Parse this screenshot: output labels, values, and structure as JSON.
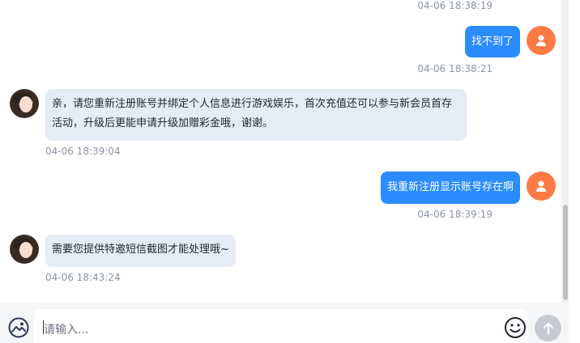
{
  "chat": {
    "messages": [
      {
        "type": "timestamp",
        "side": "right",
        "time": "04-06 18:38:19"
      },
      {
        "type": "message",
        "side": "right",
        "text": "找不到了",
        "time": "04-06 18:38:21",
        "avatar": "user-icon"
      },
      {
        "type": "message",
        "side": "left",
        "text": "亲，请您重新注册账号并绑定个人信息进行游戏娱乐，首次充值还可以参与新会员首存活动，升级后更能申请升级加赠彩金哦，谢谢。",
        "time": "04-06 18:39:04",
        "avatar": "agent-avatar"
      },
      {
        "type": "message",
        "side": "right",
        "text": "我重新注册显示账号存在啊",
        "time": "04-06 18:39:19",
        "avatar": "user-icon"
      },
      {
        "type": "message",
        "side": "left",
        "text": "需要您提供特邀短信截图才能处理哦~",
        "time": "04-06 18:43:24",
        "avatar": "agent-avatar"
      }
    ]
  },
  "composer": {
    "placeholder": "请输入...",
    "icons": {
      "image": "image-upload-icon",
      "emoji": "emoji-icon",
      "send": "send-arrow-icon"
    }
  },
  "colors": {
    "outgoing_bubble": "#2a8cff",
    "incoming_bubble": "#e6ecf5",
    "user_avatar": "#ff7a45",
    "send_button": "#c7cbd1"
  }
}
